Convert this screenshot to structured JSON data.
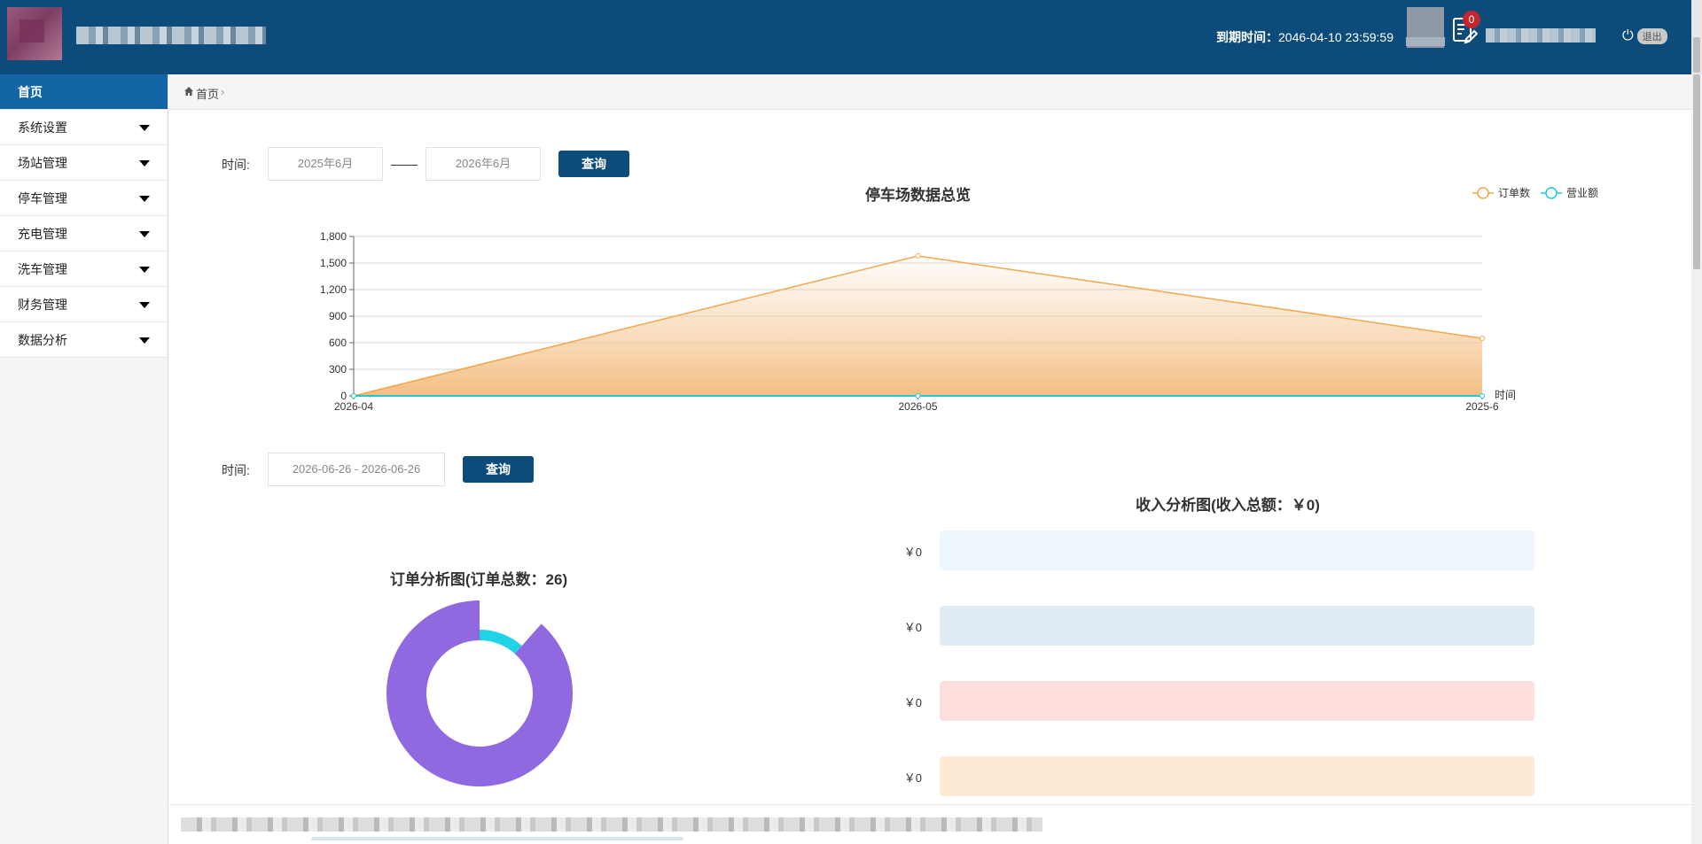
{
  "header": {
    "expire_label": "到期时间：",
    "expire_value": "2046-04-10 23:59:59",
    "badge_count": "0",
    "logout_label": "退出"
  },
  "sidebar": {
    "items": [
      {
        "label": "首页"
      },
      {
        "label": "系统设置"
      },
      {
        "label": "场站管理"
      },
      {
        "label": "停车管理"
      },
      {
        "label": "充电管理"
      },
      {
        "label": "洗车管理"
      },
      {
        "label": "财务管理"
      },
      {
        "label": "数据分析"
      }
    ]
  },
  "breadcrumb": {
    "home": "首页",
    "separator": "›"
  },
  "filter1": {
    "label": "时间:",
    "start_placeholder": "2025年6月",
    "end_placeholder": "2026年6月",
    "query_label": "查询"
  },
  "filter2": {
    "label": "时间:",
    "range_placeholder": "2026-06-26 - 2026-06-26",
    "query_label": "查询"
  },
  "chart_data": [
    {
      "type": "area",
      "title": "停车场数据总览",
      "xlabel": "时间",
      "ylabel": "",
      "categories": [
        "2026-04",
        "2026-05",
        "2025-6"
      ],
      "ylim": [
        0,
        1800
      ],
      "yticks": [
        0,
        300,
        600,
        900,
        1200,
        1500,
        1800
      ],
      "ytick_labels": [
        "0",
        "300",
        "600",
        "900",
        "1,200",
        "1,500",
        "1,800"
      ],
      "grid": true,
      "legend_position": "top-right",
      "series": [
        {
          "name": "订单数",
          "values": [
            0,
            1580,
            650
          ],
          "color": "#f3a74a"
        },
        {
          "name": "营业额",
          "values": [
            0,
            0,
            0
          ],
          "color": "#1fc8d8"
        }
      ]
    },
    {
      "type": "pie",
      "title": "订单分析图(订单总数：26)",
      "values": [
        3,
        23
      ],
      "colors": [
        "#1fd4e6",
        "#9068e0"
      ],
      "donut": true
    },
    {
      "type": "bar",
      "title": "收入分析图(收入总额：￥0)",
      "values": [
        0,
        0,
        0,
        0
      ],
      "value_labels": [
        "￥0",
        "￥0",
        "￥0",
        "￥0"
      ],
      "colors": [
        "#eef7fd",
        "#e0ecf3",
        "#fde0de",
        "#fde9d4"
      ]
    }
  ]
}
